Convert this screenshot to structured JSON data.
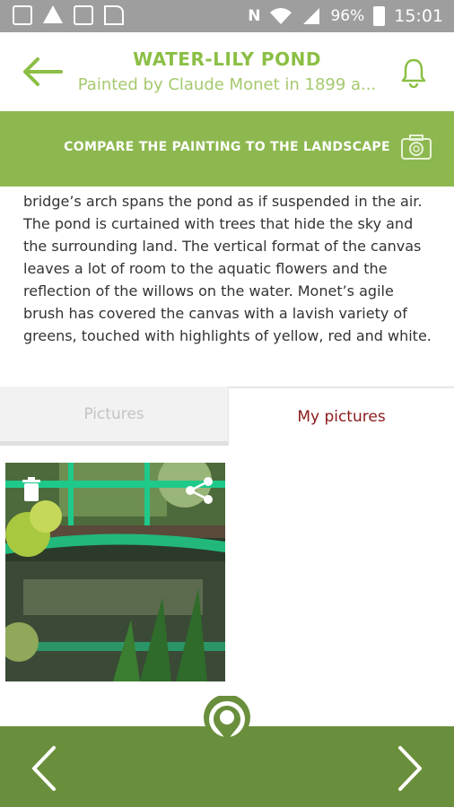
{
  "statusbar": {
    "battery": "96%",
    "time": "15:01",
    "icons": [
      "image-icon",
      "warning-icon",
      "clipboard-icon",
      "signal-flag-icon",
      "nfc-icon",
      "wifi-icon",
      "cell-signal-icon",
      "battery-icon"
    ]
  },
  "header": {
    "title": "WATER-LILY POND",
    "subtitle": "Painted by Claude Monet in 1899 a...",
    "back_icon": "arrow-left-icon",
    "bell_icon": "bell-icon"
  },
  "compare": {
    "label": "COMPARE THE PAINTING TO THE LANDSCAPE",
    "camera_icon": "camera-icon"
  },
  "description": "bridge’s arch spans the pond as if suspended in the air. The pond is curtained with trees that hide the sky and the surrounding land. The vertical format of the canvas leaves a lot of room to the aquatic flowers and the reflection of the willows on the water. Monet’s agile brush has covered the canvas with a lavish variety of greens, touched with highlights of yellow, red and white.",
  "tabs": [
    {
      "label": "Pictures",
      "active": false
    },
    {
      "label": "My pictures",
      "active": true
    }
  ],
  "colors": {
    "accent": "#8db850",
    "title_green": "#8bbf45",
    "bottom_bar": "#6a8f3c",
    "active_tab_text": "#8b1a1a"
  },
  "bottom": {
    "prev_icon": "chevron-left-icon",
    "next_icon": "chevron-right-icon",
    "pin_icon": "map-pin-icon"
  }
}
